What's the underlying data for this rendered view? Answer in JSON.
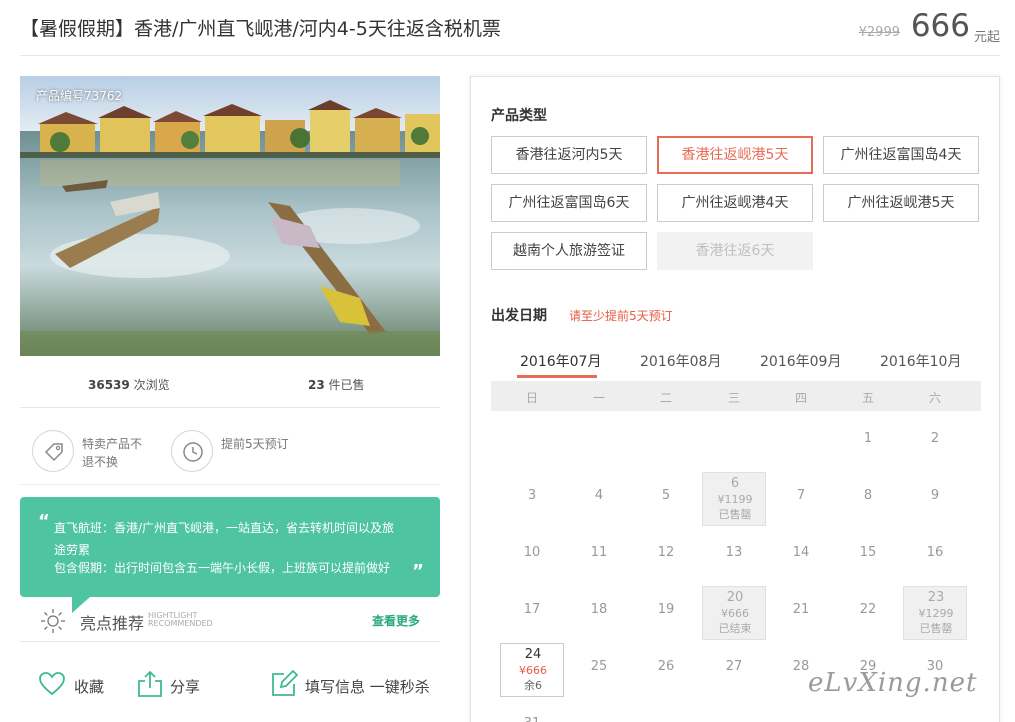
{
  "header": {
    "title": "【暑假假期】香港/广州直飞岘港/河内4-5天往返含税机票",
    "original_price": "¥2999",
    "price": "666",
    "price_unit": "元起"
  },
  "photo": {
    "product_code": "产品编号73762"
  },
  "stats": {
    "views": "36539",
    "views_label": "次浏览",
    "sold": "23",
    "sold_label": "件已售"
  },
  "features": [
    {
      "icon": "tag-icon",
      "text": "特卖产品不退不换"
    },
    {
      "icon": "clock-icon",
      "text": "提前5天预订"
    }
  ],
  "bubble": {
    "open_quote": "“",
    "close_quote": "”",
    "line1": "直飞航班：香港/广州直飞岘港，一站直达，省去转机时间以及旅途劳累",
    "line2": "包含假期：出行时间包含五一端午小长假，上班族可以提前做好"
  },
  "highlight": {
    "title": "亮点推荐",
    "en1": "HIGHTLIGHT",
    "en2": "RECOMMENDED",
    "more": "查看更多"
  },
  "actions": {
    "favorite": "收藏",
    "share": "分享",
    "fill": "填写信息 一键秒杀"
  },
  "product_type": {
    "title": "产品类型",
    "options": [
      {
        "label": "香港往返河内5天",
        "state": "normal"
      },
      {
        "label": "香港往返岘港5天",
        "state": "selected"
      },
      {
        "label": "广州往返富国岛4天",
        "state": "normal"
      },
      {
        "label": "广州往返富国岛6天",
        "state": "normal"
      },
      {
        "label": "广州往返岘港4天",
        "state": "normal"
      },
      {
        "label": "广州往返岘港5天",
        "state": "normal"
      },
      {
        "label": "越南个人旅游签证",
        "state": "normal"
      },
      {
        "label": "香港往返6天",
        "state": "disabled"
      }
    ]
  },
  "departure": {
    "title": "出发日期",
    "tip": "请至少提前5天预订",
    "months": [
      "2016年07月",
      "2016年08月",
      "2016年09月",
      "2016年10月"
    ],
    "selected_month": 0,
    "weekdays": [
      "日",
      "一",
      "二",
      "三",
      "四",
      "五",
      "六"
    ],
    "days": [
      {
        "d": "1",
        "col": 5,
        "row": 0
      },
      {
        "d": "2",
        "col": 6,
        "row": 0
      },
      {
        "d": "3",
        "col": 0,
        "row": 1
      },
      {
        "d": "4",
        "col": 1,
        "row": 1
      },
      {
        "d": "5",
        "col": 2,
        "row": 1
      },
      {
        "d": "6",
        "col": 3,
        "row": 1,
        "price": "¥1199",
        "status": "已售罄",
        "kind": "soldout"
      },
      {
        "d": "7",
        "col": 4,
        "row": 1
      },
      {
        "d": "8",
        "col": 5,
        "row": 1
      },
      {
        "d": "9",
        "col": 6,
        "row": 1
      },
      {
        "d": "10",
        "col": 0,
        "row": 2
      },
      {
        "d": "11",
        "col": 1,
        "row": 2
      },
      {
        "d": "12",
        "col": 2,
        "row": 2
      },
      {
        "d": "13",
        "col": 3,
        "row": 2
      },
      {
        "d": "14",
        "col": 4,
        "row": 2
      },
      {
        "d": "15",
        "col": 5,
        "row": 2
      },
      {
        "d": "16",
        "col": 6,
        "row": 2
      },
      {
        "d": "17",
        "col": 0,
        "row": 3
      },
      {
        "d": "18",
        "col": 1,
        "row": 3
      },
      {
        "d": "19",
        "col": 2,
        "row": 3
      },
      {
        "d": "20",
        "col": 3,
        "row": 3,
        "price": "¥666",
        "status": "已结束",
        "kind": "ended"
      },
      {
        "d": "21",
        "col": 4,
        "row": 3
      },
      {
        "d": "22",
        "col": 5,
        "row": 3
      },
      {
        "d": "23",
        "col": 6,
        "row": 3,
        "price": "¥1299",
        "status": "已售罄",
        "kind": "soldout"
      },
      {
        "d": "24",
        "col": 0,
        "row": 4,
        "price": "¥666",
        "status": "余6",
        "kind": "available"
      },
      {
        "d": "25",
        "col": 1,
        "row": 4
      },
      {
        "d": "26",
        "col": 2,
        "row": 4
      },
      {
        "d": "27",
        "col": 3,
        "row": 4
      },
      {
        "d": "28",
        "col": 4,
        "row": 4
      },
      {
        "d": "29",
        "col": 5,
        "row": 4
      },
      {
        "d": "30",
        "col": 6,
        "row": 4
      },
      {
        "d": "31",
        "col": 0,
        "row": 5
      }
    ]
  },
  "watermark": "eLvXing.net",
  "colors": {
    "accent": "#e86b55",
    "teal": "#4fc4a0",
    "link": "#2aa87f"
  }
}
